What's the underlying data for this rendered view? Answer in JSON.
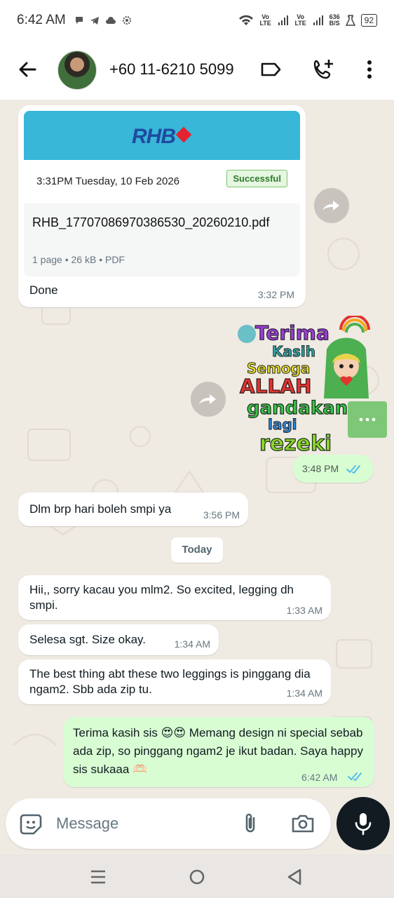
{
  "status_bar": {
    "time": "6:42 AM",
    "network_labels": [
      "Vo LTE",
      "Vo LTE"
    ],
    "speed": "636",
    "speed_unit": "B/S",
    "battery": "92"
  },
  "header": {
    "contact": "+60 11-6210 5099",
    "icons": [
      "back-arrow-icon",
      "avatar",
      "label-icon",
      "add-call-icon",
      "more-vert-icon"
    ]
  },
  "messages": {
    "doc": {
      "bank": "RHB",
      "receipt_datetime": "3:31PM Tuesday, 10 Feb 2026",
      "status": "Successful",
      "filename": "RHB_17707086970386530_20260210.pdf",
      "info": "1 page • 26 kB • PDF",
      "caption": "Done",
      "time": "3:32 PM"
    },
    "sticker": {
      "lines": [
        "Terima",
        "Kasih",
        "Semoga",
        "ALLAH",
        "gandakan",
        "lagi",
        "rezeki"
      ],
      "time": "3:48 PM"
    },
    "m1": {
      "text": "Dlm brp hari boleh smpi ya",
      "time": "3:56 PM"
    },
    "date_chip": "Today",
    "m2": {
      "text": "Hii,, sorry kacau you mlm2. So excited, legging dh smpi.",
      "time": "1:33 AM"
    },
    "m3": {
      "text": "Selesa sgt. Size okay.",
      "time": "1:34 AM"
    },
    "m4": {
      "text": "The best thing abt these two leggings is pinggang dia ngam2. Sbb ada zip tu.",
      "time": "1:34 AM"
    },
    "m5": {
      "text": "Terima kasih sis 😍😍 Memang design ni special sebab ada zip, so pinggang ngam2 je ikut badan. Saya happy sis sukaaa 🫶🏻",
      "time": "6:42 AM"
    }
  },
  "composer": {
    "placeholder": "Message"
  },
  "colors": {
    "chat_bg": "#efeae2",
    "outgoing_bubble": "#d9fdd3",
    "incoming_bubble": "#ffffff",
    "read_ticks": "#53bdeb",
    "mic_button": "#111b21"
  }
}
